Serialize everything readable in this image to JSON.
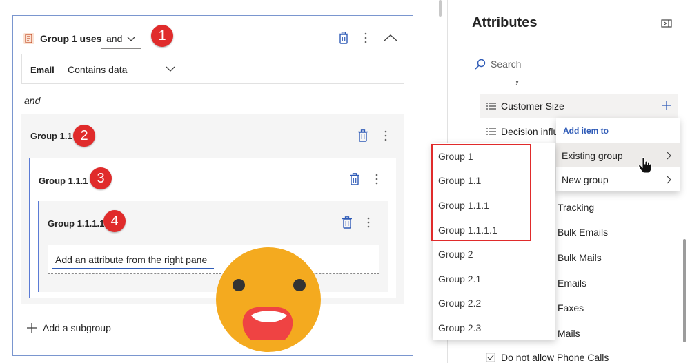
{
  "builder": {
    "group1": {
      "title": "Group 1 uses",
      "operator": "and"
    },
    "email_condition": {
      "field_label": "Email",
      "operator_value": "Contains data"
    },
    "connector": "and",
    "group_1_1": {
      "title": "Group 1.1"
    },
    "group_1_1_1": {
      "title": "Group 1.1.1"
    },
    "group_1_1_1_1": {
      "title": "Group 1.1.1.1",
      "placeholder": "Add an attribute from the right pane"
    },
    "add_subgroup": "Add a subgroup"
  },
  "badges": [
    "1",
    "2",
    "3",
    "4"
  ],
  "attributes_pane": {
    "title": "Attributes",
    "search_placeholder": "Search",
    "items": [
      {
        "label": "Customer Size",
        "icon": "list-icon"
      },
      {
        "label": "Decision influ",
        "icon": "list-icon"
      },
      {
        "label": "Tracking"
      },
      {
        "label": "Bulk Emails"
      },
      {
        "label": "Bulk Mails"
      },
      {
        "label": "Emails"
      },
      {
        "label": "Faxes"
      },
      {
        "label": "Mails"
      },
      {
        "label": "Do not allow Phone Calls",
        "icon": "checkbox-icon"
      }
    ]
  },
  "context_menu": {
    "header": "Add item to",
    "items": [
      {
        "label": "Existing group"
      },
      {
        "label": "New group"
      }
    ]
  },
  "group_list": [
    "Group 1",
    "Group 1.1",
    "Group 1.1.1",
    "Group 1.1.1.1",
    "Group 2",
    "Group 2.1",
    "Group 2.2",
    "Group 2.3"
  ],
  "colors": {
    "accent": "#5b7bd5",
    "badge_red": "#e02b2b",
    "emoji_yellow": "#f4aa1f",
    "emoji_mouth": "#ef4343"
  }
}
